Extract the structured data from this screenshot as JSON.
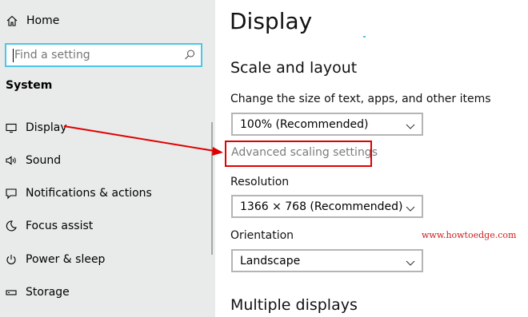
{
  "sidebar": {
    "home_label": "Home",
    "search_placeholder": "Find a setting",
    "section": "System",
    "items": [
      {
        "label": "Display",
        "icon": "monitor-icon"
      },
      {
        "label": "Sound",
        "icon": "speaker-icon"
      },
      {
        "label": "Notifications & actions",
        "icon": "notification-icon"
      },
      {
        "label": "Focus assist",
        "icon": "moon-icon"
      },
      {
        "label": "Power & sleep",
        "icon": "power-icon"
      },
      {
        "label": "Storage",
        "icon": "storage-icon"
      }
    ]
  },
  "main": {
    "title": "Display",
    "scale_heading": "Scale and layout",
    "scale_label": "Change the size of text, apps, and other items",
    "scale_value": "100% (Recommended)",
    "advanced_link": "Advanced scaling settings",
    "resolution_label": "Resolution",
    "resolution_value": "1366 × 768 (Recommended)",
    "orientation_label": "Orientation",
    "orientation_value": "Landscape",
    "multiple_heading": "Multiple displays"
  },
  "annotation": {
    "watermark": "www.howtoedge.com",
    "color": "#e00000"
  },
  "colors": {
    "sidebar_bg": "#e9eaea",
    "accent": "#4cc6e6"
  }
}
